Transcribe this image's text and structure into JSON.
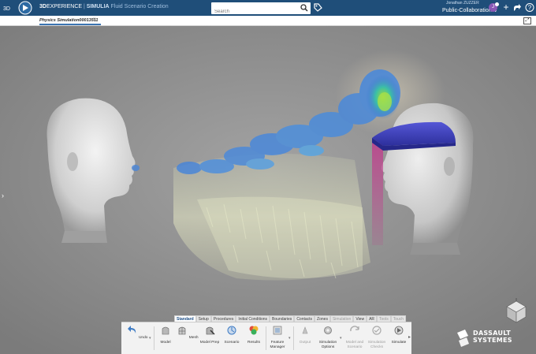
{
  "header": {
    "brand_bold": "3D",
    "brand_rest": "EXPERIENCE",
    "separator": " | ",
    "app": "SIMULIA",
    "context": "Fluid Scenario Creation",
    "search_placeholder": "Search",
    "user_name": "Jonathan ZUZZER",
    "collab_space": "Public-Collaboration",
    "avatar_initials": "J"
  },
  "tab": {
    "label": "Physics Simulation00013511",
    "close": "×"
  },
  "action_bar": {
    "section_tabs": [
      {
        "label": "Standard",
        "active": true,
        "dim": false
      },
      {
        "label": "Setup",
        "active": false,
        "dim": false
      },
      {
        "label": "Procedures",
        "active": false,
        "dim": false
      },
      {
        "label": "Initial Conditions",
        "active": false,
        "dim": false
      },
      {
        "label": "Boundaries",
        "active": false,
        "dim": false
      },
      {
        "label": "Contacts",
        "active": false,
        "dim": false
      },
      {
        "label": "Zones",
        "active": false,
        "dim": false
      },
      {
        "label": "Simulation",
        "active": false,
        "dim": true
      },
      {
        "label": "View",
        "active": false,
        "dim": false
      },
      {
        "label": "AR",
        "active": false,
        "dim": false
      },
      {
        "label": "Tools",
        "active": false,
        "dim": true
      },
      {
        "label": "Touch",
        "active": false,
        "dim": true
      }
    ],
    "commands": [
      {
        "label": "Undo",
        "dim": false
      },
      {
        "label": "Model",
        "dim": false
      },
      {
        "label": "Mesh",
        "dim": false
      },
      {
        "label": "Model Prep",
        "dim": false
      },
      {
        "label": "Scenario",
        "dim": false
      },
      {
        "label": "Results",
        "dim": false
      },
      {
        "label": "Feature Manager",
        "dim": false
      },
      {
        "label": "Output",
        "dim": true
      },
      {
        "label": "Simulation Options",
        "dim": false
      },
      {
        "label": "Model and Scenario",
        "dim": true
      },
      {
        "label": "Simulation Checks",
        "dim": true
      },
      {
        "label": "Simulate",
        "dim": false
      }
    ]
  },
  "logo": {
    "line1": "DASSAULT",
    "line2": "SYSTEMES"
  },
  "colors": {
    "header_bg": "#1f4e79",
    "viewport_bg": "#8d8d8d",
    "face_shield": "#3c3fb8",
    "accent": "#3b74b1"
  }
}
